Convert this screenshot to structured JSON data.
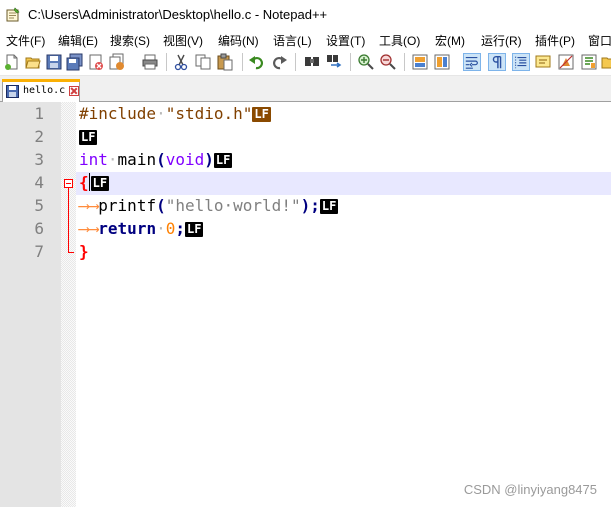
{
  "window": {
    "title": "C:\\Users\\Administrator\\Desktop\\hello.c - Notepad++"
  },
  "menu": [
    "文件(F)",
    "编辑(E)",
    "搜索(S)",
    "视图(V)",
    "编码(N)",
    "语言(L)",
    "设置(T)",
    "工具(O)",
    "宏(M)",
    "运行(R)",
    "插件(P)",
    "窗口"
  ],
  "toolbar": {
    "icons": [
      "new-file-icon",
      "open-file-icon",
      "save-icon",
      "save-all-icon",
      "close-icon",
      "close-all-icon",
      "print-icon",
      "cut-icon",
      "copy-icon",
      "paste-icon",
      "undo-icon",
      "redo-icon",
      "find-icon",
      "replace-icon",
      "zoom-in-icon",
      "zoom-out-icon",
      "sync-vertical-icon",
      "sync-horizontal-icon",
      "word-wrap-icon",
      "show-all-chars-icon",
      "indent-guide-icon",
      "doc-map-icon",
      "function-list-icon",
      "folder-workspace-icon"
    ]
  },
  "tabs": [
    {
      "label": "hello.c",
      "active": true
    }
  ],
  "editor": {
    "line_numbers": [
      "1",
      "2",
      "3",
      "4",
      "5",
      "6",
      "7"
    ],
    "eol_marker": "LF",
    "current_line": 4
  },
  "watermark": "CSDN @linyiyang8475",
  "colors": {
    "gutter": "#e4e4e4",
    "current_line": "#e8e8ff",
    "preprocessor": "#804000",
    "keyword": "#8000ff",
    "string": "#808080",
    "number": "#ff8000",
    "operator": "#000080",
    "brace_match": "#ff0000"
  }
}
